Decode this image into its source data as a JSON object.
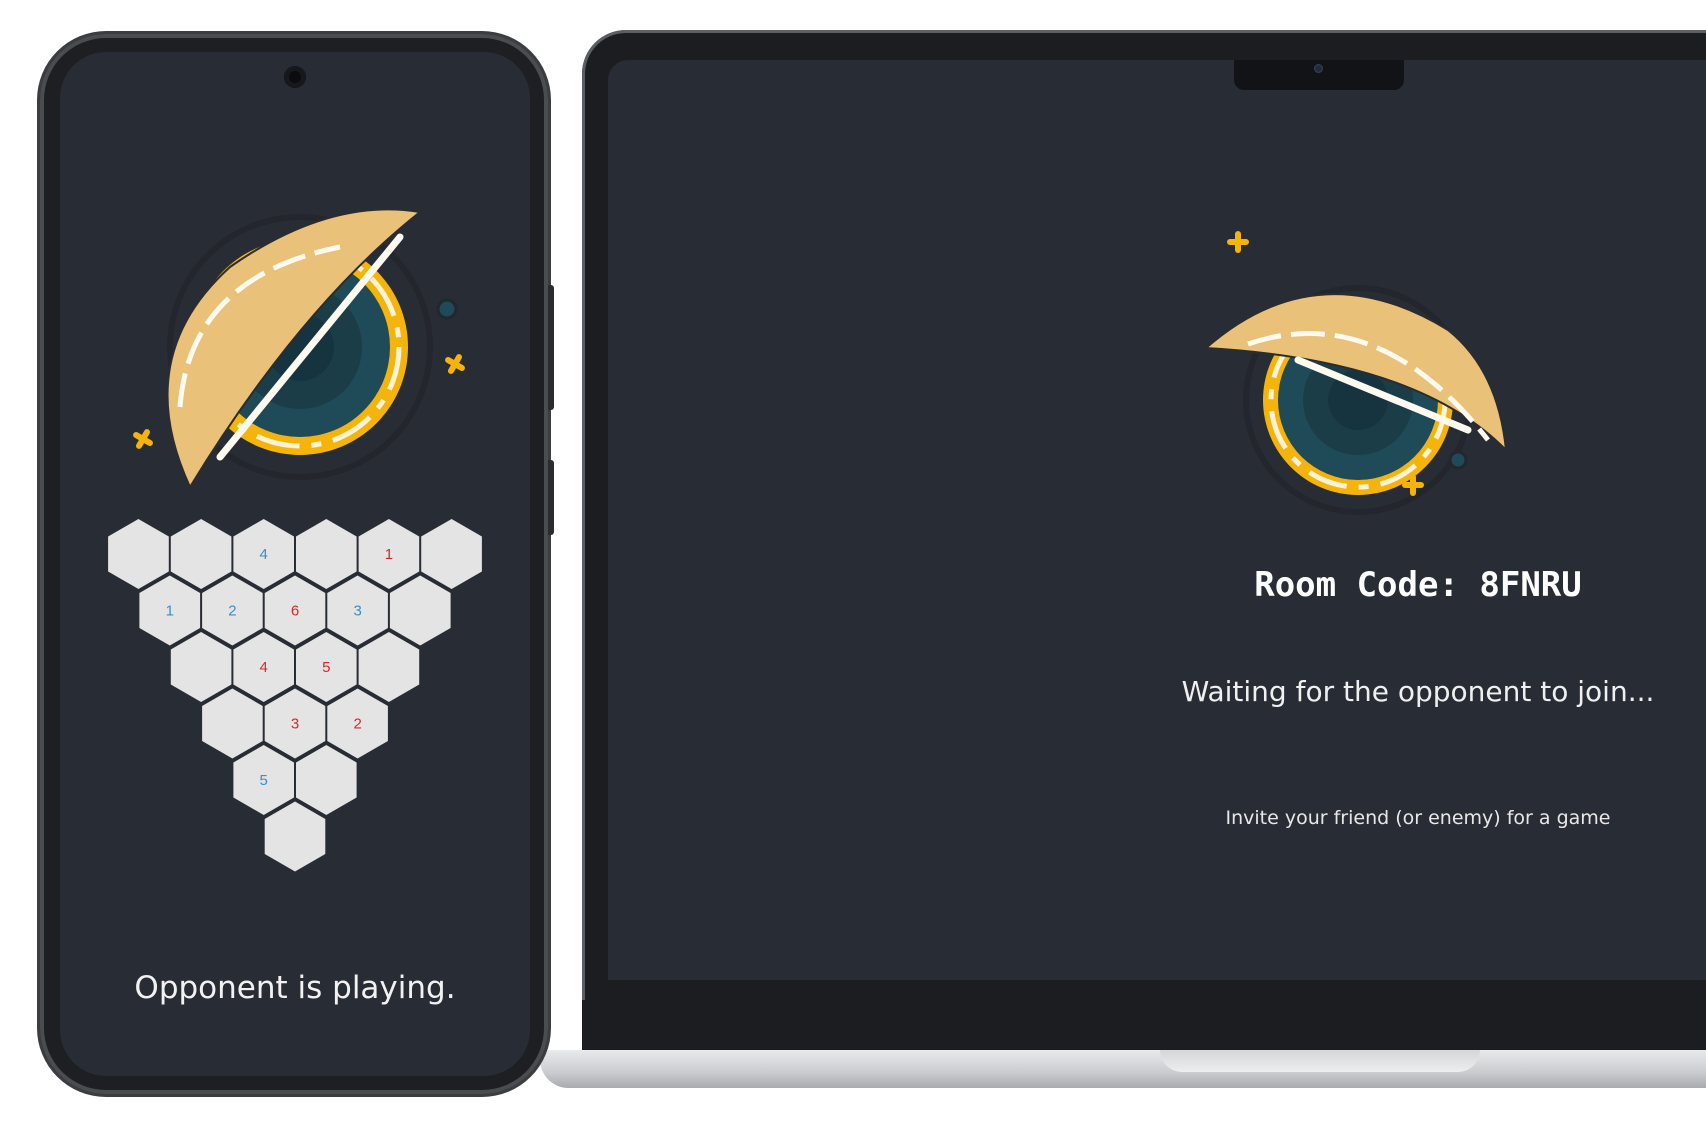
{
  "laptop": {
    "room_code": "Room Code: 8FNRU",
    "waiting_message": "Waiting for the opponent to join...",
    "invite_message": "Invite your friend (or enemy) for a game"
  },
  "phone": {
    "status_message": "Opponent is playing."
  },
  "board": {
    "rows": [
      [
        {
          "value": "",
          "color": ""
        },
        {
          "value": "",
          "color": ""
        },
        {
          "value": "4",
          "color": "blue"
        },
        {
          "value": "",
          "color": ""
        },
        {
          "value": "1",
          "color": "red"
        },
        {
          "value": "",
          "color": ""
        }
      ],
      [
        {
          "value": "1",
          "color": "blue"
        },
        {
          "value": "2",
          "color": "blue"
        },
        {
          "value": "6",
          "color": "red"
        },
        {
          "value": "3",
          "color": "blue"
        },
        {
          "value": "",
          "color": ""
        }
      ],
      [
        {
          "value": "",
          "color": ""
        },
        {
          "value": "4",
          "color": "red"
        },
        {
          "value": "5",
          "color": "red"
        },
        {
          "value": "",
          "color": ""
        }
      ],
      [
        {
          "value": "",
          "color": ""
        },
        {
          "value": "3",
          "color": "red"
        },
        {
          "value": "2",
          "color": "red"
        }
      ],
      [
        {
          "value": "5",
          "color": "blue"
        },
        {
          "value": "",
          "color": ""
        }
      ],
      [
        {
          "value": "",
          "color": ""
        }
      ]
    ]
  },
  "colors": {
    "background": "#282c35",
    "hex_fill": "#e4e4e4",
    "blue": "#3a8fc7",
    "red": "#d62828",
    "logo_gold": "#f5b40c",
    "logo_cream": "#e9c179",
    "logo_teal": "#1f4a57"
  },
  "icons": {
    "logo": "orbit-slash-logo",
    "sparkle": "plus-sparkle-icon",
    "dot": "planet-dot-icon"
  }
}
